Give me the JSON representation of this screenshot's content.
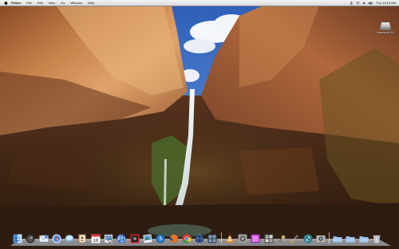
{
  "menubar": {
    "apple_icon": "apple-icon",
    "items": [
      {
        "label": "Finder"
      },
      {
        "label": "File"
      },
      {
        "label": "Edit"
      },
      {
        "label": "View"
      },
      {
        "label": "Go"
      },
      {
        "label": "Window"
      },
      {
        "label": "Help"
      }
    ],
    "status_icons": [
      "bluetooth-icon",
      "wifi-icon",
      "volume-icon",
      "battery-icon"
    ],
    "clock": "Thu 10:15 AM"
  },
  "desktop": {
    "drive_label": "Macintosh HD"
  },
  "dock": {
    "items": [
      {
        "name": "finder",
        "icon": "finder-icon"
      },
      {
        "name": "dashboard",
        "icon": "dashboard-icon"
      },
      {
        "name": "mail",
        "icon": "mail-icon"
      },
      {
        "name": "safari",
        "icon": "safari-icon"
      },
      {
        "name": "ichat",
        "icon": "ichat-icon"
      },
      {
        "name": "address-book",
        "icon": "address-book-icon"
      },
      {
        "name": "ical",
        "icon": "ical-icon"
      },
      {
        "name": "preview",
        "icon": "preview-icon"
      },
      {
        "name": "itunes",
        "icon": "itunes-icon"
      },
      {
        "name": "photo-booth",
        "icon": "photo-booth-icon"
      },
      {
        "name": "iphoto",
        "icon": "iphoto-icon"
      },
      {
        "name": "time-machine",
        "icon": "time-machine-icon"
      },
      {
        "name": "firefox",
        "icon": "firefox-icon"
      },
      {
        "name": "chrome",
        "icon": "chrome-icon"
      },
      {
        "name": "network-globe",
        "icon": "globe-icon"
      },
      {
        "name": "spaces",
        "icon": "spaces-icon"
      },
      {
        "name": "vlc",
        "icon": "vlc-icon"
      },
      {
        "name": "system-preferences",
        "icon": "system-preferences-icon"
      },
      {
        "name": "media-app",
        "icon": "media-app-icon"
      },
      {
        "name": "expose",
        "icon": "expose-icon"
      },
      {
        "name": "utility",
        "icon": "utility-icon"
      },
      {
        "name": "xcode",
        "icon": "xcode-icon"
      },
      {
        "name": "activity",
        "icon": "activity-icon"
      },
      {
        "name": "image-capture",
        "icon": "image-capture-icon"
      },
      {
        "name": "applications-folder",
        "icon": "folder-icon"
      },
      {
        "name": "documents-folder",
        "icon": "folder-icon"
      },
      {
        "name": "downloads-folder",
        "icon": "folder-icon"
      },
      {
        "name": "trash",
        "icon": "trash-icon"
      }
    ]
  }
}
